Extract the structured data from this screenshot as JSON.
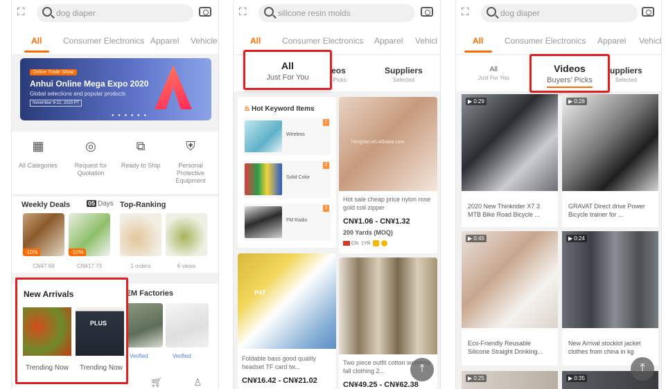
{
  "colors": {
    "accent": "#ff6a00",
    "highlight": "#e02020"
  },
  "icons": {
    "scan": "scan-icon",
    "search": "search-icon",
    "camera": "camera-icon",
    "to_top": "arrow-up-icon"
  },
  "panel1": {
    "search_placeholder": "dog diaper",
    "categories": [
      "All",
      "Consumer Electronics",
      "Apparel",
      "Vehicle"
    ],
    "banner": {
      "tag": "Online Trade Show",
      "title": "Anhui Online Mega Expo 2020",
      "subtitle": "Global selections and popular products",
      "date": "November 9-22, 2020 PT",
      "dots": "● ● ● ● ● ●"
    },
    "quick_links": [
      "All Categories",
      "Request for Quotation",
      "Ready to Ship",
      "Personal Protective Equipment"
    ],
    "weekly_deals": {
      "title": "Weekly Deals",
      "days_count": "05",
      "days_label": "Days",
      "items": [
        {
          "badge": "-10%",
          "price": "CN¥7.69"
        },
        {
          "badge": "-10%",
          "price": "CN¥17.73"
        }
      ]
    },
    "top_ranking": {
      "title": "Top-Ranking",
      "items": [
        {
          "caption": "1 orders"
        },
        {
          "caption": "6 views"
        }
      ]
    },
    "new_arrivals": {
      "title": "New Arrivals",
      "items": [
        {
          "caption": "Trending Now"
        },
        {
          "caption": "Trending Now",
          "label": "PLUS"
        }
      ]
    },
    "oem": {
      "title": "OEM Factories",
      "verified": [
        "Verified",
        "Verified"
      ]
    }
  },
  "panel2": {
    "search_placeholder": "silicone resin molds",
    "categories": [
      "All",
      "Consumer Electronics",
      "Apparel",
      "Vehicl"
    ],
    "tabs": [
      {
        "title": "All",
        "sub": "Just For You"
      },
      {
        "title": "eos",
        "sub": "' Picks"
      },
      {
        "title": "Suppliers",
        "sub": "Selected"
      }
    ],
    "hot_keywords": {
      "title": "Hot Keyword Items",
      "items": [
        {
          "label": "Wireless",
          "rank": "1"
        },
        {
          "label": "Solid Color",
          "rank": "2"
        },
        {
          "label": "FM Radio",
          "rank": "3"
        }
      ]
    },
    "products": [
      {
        "title": "Hot sale cheap price nylon rose gold coil zipper",
        "price": "CN¥1.06 - CN¥1.32",
        "moq": "200 Yards (MOQ)",
        "country": "CN",
        "years": "1YR",
        "watermark": "hengtian.en.alibaba.com"
      },
      {
        "title": "Foldable bass good quality headset TF card tw...",
        "price": "CN¥16.42 - CN¥21.02",
        "brand": "P47"
      },
      {
        "title": "Two piece outfit cotton womens fall clothing 2...",
        "price": "CN¥49.25 - CN¥62.38"
      }
    ]
  },
  "panel3": {
    "search_placeholder": "dog diaper",
    "categories": [
      "All",
      "Consumer Electronics",
      "Apparel",
      "Vehicle"
    ],
    "tabs": [
      {
        "title": "All",
        "sub": "Just For You"
      },
      {
        "title": "Videos",
        "sub": "Buyers' Picks"
      },
      {
        "title": "uppliers",
        "sub": "Selected"
      }
    ],
    "videos": [
      {
        "duration": "0:29",
        "title": "2020 New Thinkrider X7 3 MTB Bike Road Bicycle ..."
      },
      {
        "duration": "0:28",
        "title": "GRAVAT Direct drive Power Bicycle trainer for ..."
      },
      {
        "duration": "0:45",
        "title": "Eco-Friendly Reusable Silicone Straight Drinking..."
      },
      {
        "duration": "0:24",
        "title": "New Arrival stocklot jacket clothes from china in kg"
      },
      {
        "duration": "0:25"
      },
      {
        "duration": "0:35"
      }
    ]
  }
}
